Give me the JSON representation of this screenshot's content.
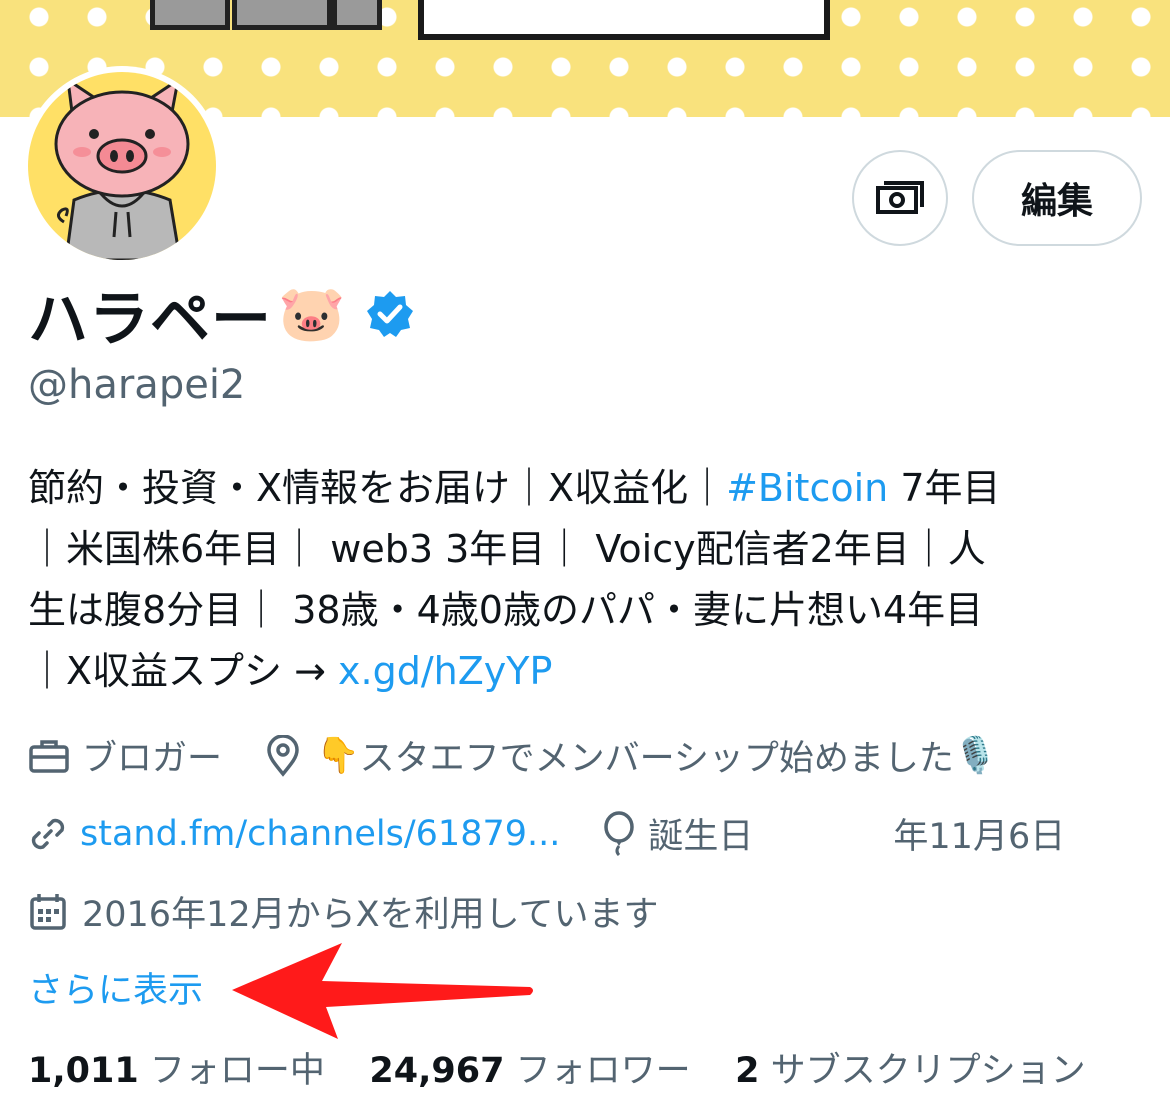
{
  "header": {
    "edit_label": "編集"
  },
  "profile": {
    "display_name": "ハラペー",
    "name_emoji": "🐷",
    "handle": "@harapei2",
    "verified": true
  },
  "bio": {
    "line1_text": "節約・投資・X情報をお届け｜X収益化｜",
    "line1_hashtag": "#Bitcoin",
    "line1_tail": " 7年目",
    "line2": "｜米国株6年目｜ web3 3年目｜ Voicy配信者2年目｜人",
    "line3": "生は腹8分目｜ 38歳・4歳0歳のパパ・妻に片想い4年目",
    "line4_text": "｜X収益スプシ → ",
    "line4_link": "x.gd/hZyYP"
  },
  "meta": {
    "category": "ブロガー",
    "location_emoji": "👇",
    "location": "スタエフでメンバーシップ始めました",
    "location_tail_emoji": "🎙️",
    "website": "stand.fm/channels/61879...",
    "birthday_label": "誕生日",
    "birthday_value": "年11月6日",
    "joined": "2016年12月からXを利用しています"
  },
  "show_more": "さらに表示",
  "stats": {
    "following_count": "1,011",
    "following_label": "フォロー中",
    "followers_count": "24,967",
    "followers_label": "フォロワー",
    "subs_count": "2",
    "subs_label": "サブスクリプション"
  },
  "colors": {
    "accent": "#1d9bf0",
    "muted": "#536471",
    "banner": "#f9e27d",
    "arrow": "#ff1a1a"
  }
}
